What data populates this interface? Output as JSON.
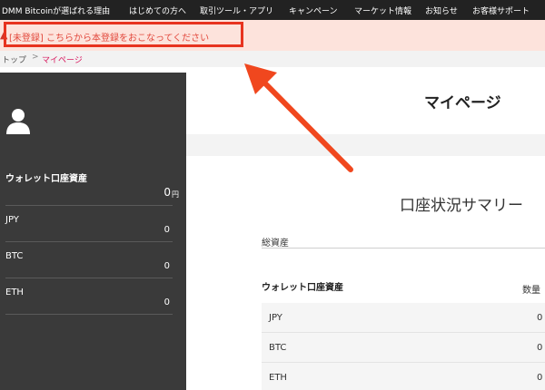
{
  "topnav": {
    "items": [
      "DMM Bitcoinが選ばれる理由",
      "はじめての方へ",
      "取引ツール・アプリ",
      "キャンペーン",
      "マーケット情報",
      "お知らせ",
      "お客様サポート"
    ]
  },
  "alert": {
    "icon": "warning-icon",
    "message": "[未登録] こちらから本登録をおこなってください"
  },
  "breadcrumb": {
    "home": "トップ",
    "separator": ">",
    "current": "マイページ"
  },
  "sidebar": {
    "avatar_icon": "user-icon",
    "wallet_title": "ウォレット口座資産",
    "total_value": "0",
    "total_unit": "円",
    "currencies": [
      {
        "label": "JPY",
        "value": "0"
      },
      {
        "label": "BTC",
        "value": "0"
      },
      {
        "label": "ETH",
        "value": "0"
      }
    ]
  },
  "main": {
    "page_title": "マイページ",
    "summary_title": "口座状況サマリー",
    "total_assets_label": "総資産",
    "wallet_label": "ウォレット口座資産",
    "quantity_label": "数量",
    "rows": [
      {
        "label": "JPY",
        "value": "0"
      },
      {
        "label": "BTC",
        "value": "0"
      },
      {
        "label": "ETH",
        "value": "0"
      }
    ]
  },
  "colors": {
    "nav_bg": "#222222",
    "alert_bg": "#fde3dc",
    "alert_text": "#e2483c",
    "highlight_red": "#e7331f",
    "breadcrumb_current": "#d81b60",
    "sidebar_bg": "#3a3a3a"
  }
}
